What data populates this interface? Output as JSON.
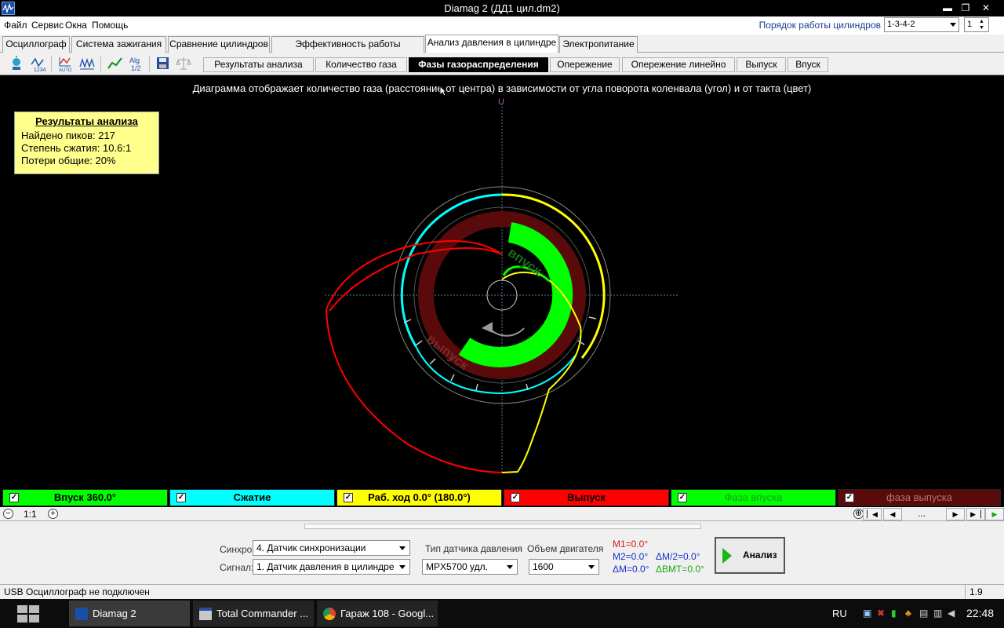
{
  "window": {
    "title": "Diamag 2 (ДД1 цил.dm2)",
    "minimize": "▬",
    "maximize": "❐",
    "close": "✕"
  },
  "menu": {
    "items": [
      "Файл",
      "Сервис",
      "Окна",
      "Помощь"
    ],
    "cylinder_order_label": "Порядок работы цилиндров",
    "cylinder_order_value": "1-3-4-2",
    "cylinder_number": "1"
  },
  "tabs": [
    "Осциллограф",
    "Система зажигания",
    "Сравнение цилиндров",
    "Эффективность работы цилиндров",
    "Анализ давления в цилиндре",
    "Электропитание"
  ],
  "active_tab": "Анализ давления в цилиндре",
  "subtabs": [
    "Результаты анализа",
    "Количество газа",
    "Фазы газораспределения",
    "Опережение",
    "Опережение линейно",
    "Выпуск",
    "Впуск"
  ],
  "active_subtab": "Фазы газораспределения",
  "toolbar_icons": [
    "sensor-icon",
    "numbering-icon",
    "auto-scale-icon",
    "peak-detect-icon",
    "trend-icon",
    "algorithm-icon",
    "save-icon",
    "scales-icon"
  ],
  "plot": {
    "caption": "Диаграмма отображает количество газа (расстояние от центра) в зависимости от угла поворота коленвала (угол) и от такта (цвет)",
    "results": {
      "title": "Результаты анализа",
      "peaks": "Найдено пиков: 217",
      "compression": "Степень сжатия: 10.6:1",
      "losses": "Потери общие: 20%"
    },
    "labels": {
      "intake_arc": "впуск",
      "exhaust_arc": "выпуск",
      "top_marker": "U"
    },
    "colors": {
      "intake": "#00ff00",
      "compression": "#00ffff",
      "power": "#ffff00",
      "exhaust": "#ff0000",
      "exhaust_phase": "#5a0a0a"
    }
  },
  "legend": [
    {
      "label": "Впуск 360.0°",
      "bg": "#00ff00",
      "fg": "#000000"
    },
    {
      "label": "Сжатие",
      "bg": "#00ffff",
      "fg": "#000000"
    },
    {
      "label": "Раб. ход 0.0° (180.0°)",
      "bg": "#ffff00",
      "fg": "#000000"
    },
    {
      "label": "Выпуск",
      "bg": "#ff0000",
      "fg": "#000000"
    },
    {
      "label": "Фаза впуска",
      "bg": "#00ff00",
      "fg": "#1a9a1a"
    },
    {
      "label": "фаза выпуска",
      "bg": "#5a0a0a",
      "fg": "#b07a7a"
    }
  ],
  "zoom": {
    "minus": "−",
    "value": "1:1",
    "plus": "+",
    "nav_dots": "..."
  },
  "controls": {
    "sync_label": "Синхро:",
    "sync_value": "4.  Датчик синхронизации",
    "signal_label": "Сигнал:",
    "signal_value": "1.  Датчик давления в цилиндре",
    "sensor_type_label": "Тип датчика давления",
    "sensor_type_value": "MPX5700 удл.",
    "engine_volume_label": "Объем двигателя",
    "engine_volume_value": "1600",
    "m1": "M1=0.0°",
    "m2": "M2=0.0°",
    "dm": "ΔM=0.0°",
    "dm2": "ΔM/2=0.0°",
    "dbmt": "ΔВМТ=0.0°",
    "analyze": "Анализ"
  },
  "status": {
    "left": "USB Осциллограф не подключен",
    "right": "1.9"
  },
  "taskbar": {
    "tasks": [
      "Diamag 2",
      "Total Commander ...",
      "Гараж 108 - Googl..."
    ],
    "lang": "RU",
    "time": "22:48"
  }
}
